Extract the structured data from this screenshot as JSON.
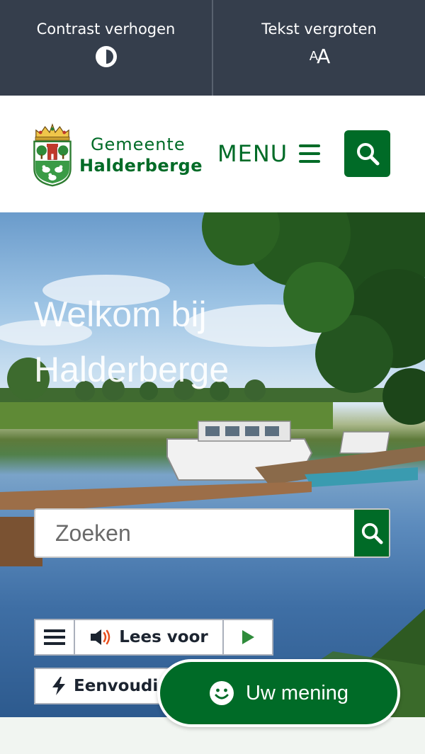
{
  "accessibility_bar": {
    "contrast_label": "Contrast verhogen",
    "text_size_label": "Tekst vergroten",
    "text_size_glyph_small": "A",
    "text_size_glyph_big": "A"
  },
  "header": {
    "logo_line1": "Gemeente",
    "logo_line2": "Halderberge",
    "menu_label": "MENU"
  },
  "hero": {
    "title": "Welkom bij Halderberge",
    "search_placeholder": "Zoeken"
  },
  "readspeaker": {
    "read_label": "Lees voor"
  },
  "simple_mode": {
    "label": "Eenvoudig"
  },
  "feedback": {
    "label": "Uw mening"
  },
  "colors": {
    "brand_green": "#006b27",
    "a11y_bar": "#353e4c"
  },
  "icons": [
    "contrast-icon",
    "text-size-icon",
    "hamburger-icon",
    "search-icon",
    "speaker-icon",
    "play-icon",
    "lightning-icon",
    "smiley-icon"
  ]
}
